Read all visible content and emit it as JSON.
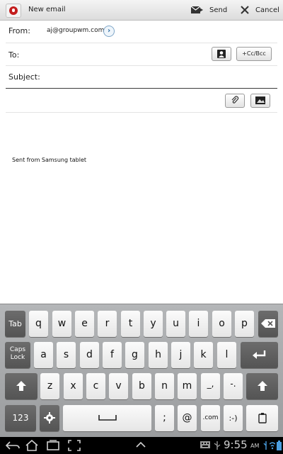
{
  "header": {
    "title": "New email",
    "send_label": "Send",
    "cancel_label": "Cancel"
  },
  "compose": {
    "from_label": "From:",
    "from_value": "aj@groupwm.com",
    "to_label": "To:",
    "cc_bcc_label": "+Cc/Bcc",
    "subject_label": "Subject:",
    "body": "Sent from Samsung tablet"
  },
  "keyboard": {
    "row1": [
      "q",
      "w",
      "e",
      "r",
      "t",
      "y",
      "u",
      "i",
      "o",
      "p"
    ],
    "row2": [
      "a",
      "s",
      "d",
      "f",
      "g",
      "h",
      "j",
      "k",
      "l"
    ],
    "row3": [
      "z",
      "x",
      "c",
      "v",
      "b",
      "n",
      "m"
    ],
    "tab": "Tab",
    "caps_lock": "Caps Lock",
    "num": "123",
    "punct_comma": "_,",
    "punct_dash": "-.",
    "semicolon": ";",
    "at": "@",
    "dotcom": ".com",
    "smiley": ":-)"
  },
  "status": {
    "time": "9:55",
    "ampm": "AM"
  },
  "icons": [
    "compose-app-icon",
    "send-icon",
    "close-icon",
    "arrow-right-icon",
    "contact-icon",
    "paperclip-icon",
    "image-icon",
    "backspace-icon",
    "enter-icon",
    "shift-icon",
    "settings-icon",
    "space-icon",
    "clipboard-icon",
    "back-icon",
    "home-icon",
    "recent-apps-icon",
    "screenshot-icon",
    "chevron-up-icon",
    "keyboard-icon",
    "usb-icon",
    "wifi-icon",
    "battery-icon"
  ],
  "colors": {
    "accent_red": "#c31d1d",
    "link_blue": "#2b6ca3",
    "keyboard_bg": "#a8aaac"
  }
}
